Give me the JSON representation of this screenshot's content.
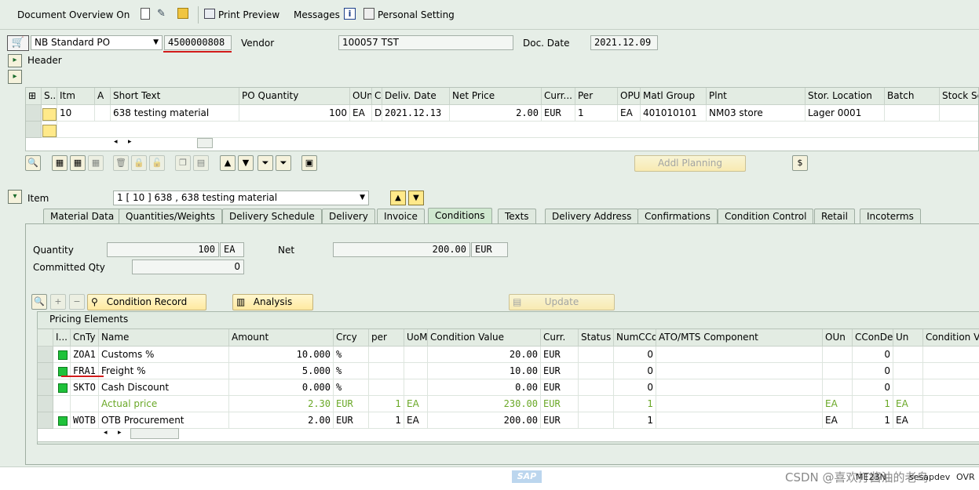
{
  "toolbar": {
    "doc_overview": "Document Overview On",
    "print_preview": "Print Preview",
    "messages": "Messages",
    "personal_setting": "Personal Setting"
  },
  "header": {
    "doc_type": "NB Standard PO",
    "po_number": "4500000808",
    "vendor_label": "Vendor",
    "vendor_value": "100057 TST",
    "doc_date_label": "Doc. Date",
    "doc_date_value": "2021.12.09",
    "header_label": "Header"
  },
  "items_table": {
    "columns": [
      "S..",
      "Itm",
      "A",
      "Short Text",
      "PO Quantity",
      "OUn",
      "C",
      "Deliv. Date",
      "Net Price",
      "Curr...",
      "Per",
      "OPU",
      "Matl Group",
      "Plnt",
      "Stor. Location",
      "Batch",
      "Stock Se"
    ],
    "rows": [
      {
        "itm": "10",
        "a": "",
        "short_text": "638 testing material",
        "po_qty": "100",
        "oun": "EA",
        "c": "D",
        "deliv_date": "2021.12.13",
        "net_price": "2.00",
        "curr": "EUR",
        "per": "1",
        "opu": "EA",
        "matl_group": "401010101",
        "plnt": "NM03 store",
        "stor_loc": "Lager 0001",
        "batch": "",
        "stock": ""
      }
    ],
    "addl_planning": "Addl Planning"
  },
  "item_section": {
    "label": "Item",
    "selected": "1 [ 10 ] 638 , 638 testing material"
  },
  "tabs": [
    "Material Data",
    "Quantities/Weights",
    "Delivery Schedule",
    "Delivery",
    "Invoice",
    "Conditions",
    "Texts",
    "Delivery Address",
    "Confirmations",
    "Condition Control",
    "Retail",
    "Incoterms"
  ],
  "active_tab": "Conditions",
  "conditions": {
    "quantity_label": "Quantity",
    "quantity_value": "100",
    "quantity_unit": "EA",
    "net_label": "Net",
    "net_value": "200.00",
    "net_curr": "EUR",
    "committed_label": "Committed Qty",
    "committed_value": "0",
    "condition_record_btn": "Condition Record",
    "analysis_btn": "Analysis",
    "update_btn": "Update",
    "pricing_title": "Pricing Elements"
  },
  "pricing_table": {
    "columns": [
      "I...",
      "CnTy",
      "Name",
      "Amount",
      "Crcy",
      "per",
      "UoM",
      "Condition Value",
      "Curr.",
      "Status",
      "NumCCo",
      "ATO/MTS Component",
      "OUn",
      "CConDe",
      "Un",
      "Condition Va"
    ],
    "rows": [
      {
        "light": true,
        "cnty": "ZOA1",
        "name": "Customs %",
        "amount": "10.000",
        "crcy": "%",
        "per": "",
        "uom": "",
        "cond_value": "20.00",
        "curr": "EUR",
        "status": "",
        "numcco": "0",
        "ato": "",
        "oun": "",
        "ccon": "0",
        "un": "",
        "green": false
      },
      {
        "light": true,
        "cnty": "FRA1",
        "name": "Freight %",
        "amount": "5.000",
        "crcy": "%",
        "per": "",
        "uom": "",
        "cond_value": "10.00",
        "curr": "EUR",
        "status": "",
        "numcco": "0",
        "ato": "",
        "oun": "",
        "ccon": "0",
        "un": "",
        "green": false
      },
      {
        "light": true,
        "cnty": "SKTO",
        "name": "Cash Discount",
        "amount": "0.000",
        "crcy": "%",
        "per": "",
        "uom": "",
        "cond_value": "0.00",
        "curr": "EUR",
        "status": "",
        "numcco": "0",
        "ato": "",
        "oun": "",
        "ccon": "0",
        "un": "",
        "green": false
      },
      {
        "light": false,
        "cnty": "",
        "name": "Actual price",
        "amount": "2.30",
        "crcy": "EUR",
        "per": "1",
        "uom": "EA",
        "cond_value": "230.00",
        "curr": "EUR",
        "status": "",
        "numcco": "1",
        "ato": "",
        "oun": "EA",
        "ccon": "1",
        "un": "EA",
        "green": true
      },
      {
        "light": true,
        "cnty": "WOTB",
        "name": "OTB Procurement",
        "amount": "2.00",
        "crcy": "EUR",
        "per": "1",
        "uom": "EA",
        "cond_value": "200.00",
        "curr": "EUR",
        "status": "",
        "numcco": "1",
        "ato": "",
        "oun": "EA",
        "ccon": "1",
        "un": "EA",
        "green": false
      }
    ]
  },
  "status_bar": {
    "watermark": "CSDN @喜欢打酱油的老鸟",
    "tcode": "ME23N",
    "server": "sesapdev",
    "mode": "OVR"
  },
  "colors": {
    "background": "#e6eee7",
    "red_underline": "#d21b1b",
    "status_green": "#1fc23a",
    "subtotal_green": "#6aa827"
  }
}
